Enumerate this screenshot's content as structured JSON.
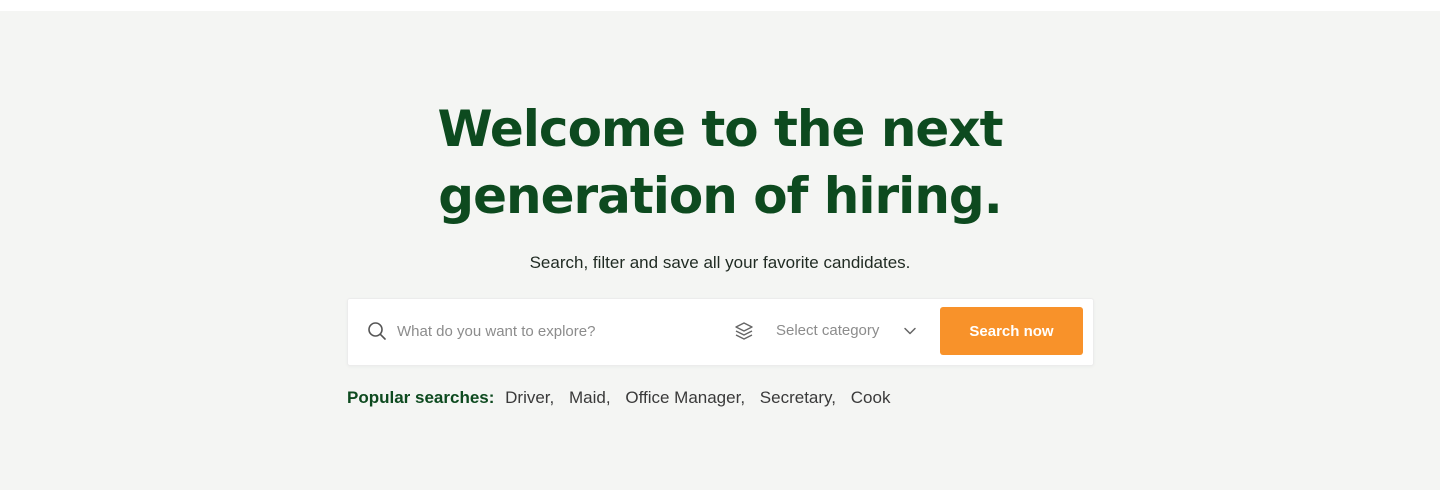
{
  "hero": {
    "headline_line1": "Welcome to the next",
    "headline_line2": "generation of hiring.",
    "subtitle": "Search, filter and save all your favorite candidates."
  },
  "search": {
    "icon": "search-icon",
    "placeholder": "What do you want to explore?",
    "category_icon": "layers-icon",
    "category_placeholder": "Select category",
    "category_chevron": "chevron-down-icon",
    "button_label": "Search now"
  },
  "popular": {
    "label": "Popular searches:",
    "items": [
      "Driver",
      "Maid",
      "Office Manager",
      "Secretary",
      "Cook"
    ]
  },
  "colors": {
    "background": "#f4f5f3",
    "headline": "#0d4a1f",
    "accent": "#f8922a",
    "muted_text": "#8c8c8c"
  }
}
